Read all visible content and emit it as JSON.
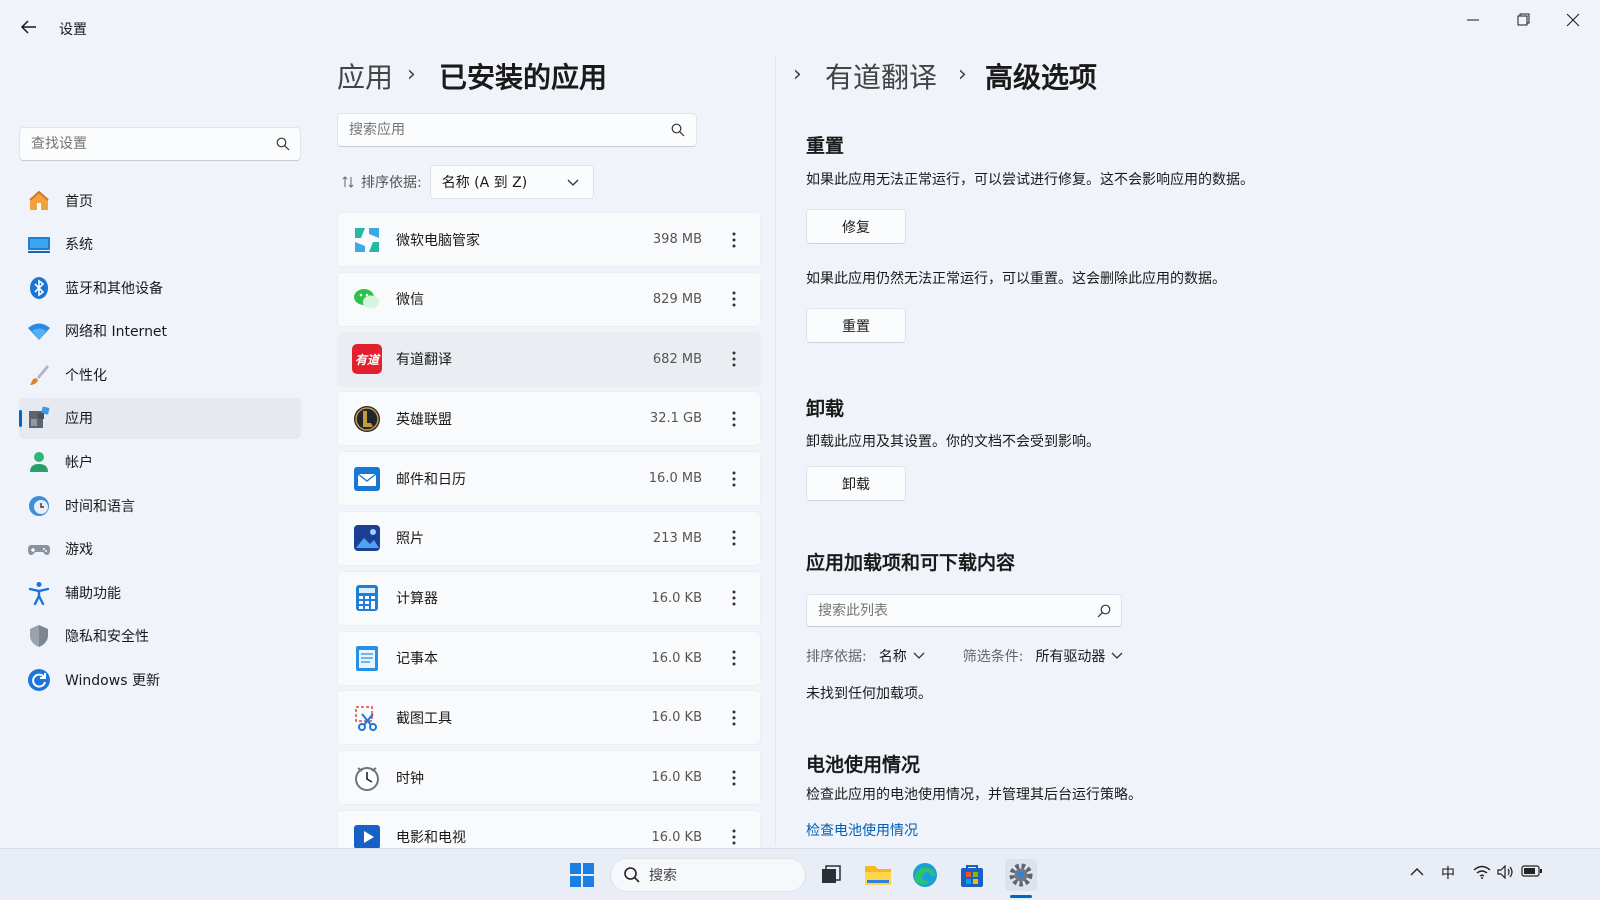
{
  "window": {
    "title": "设置"
  },
  "sidebar": {
    "search_placeholder": "查找设置",
    "items": [
      {
        "label": "首页",
        "icon": "home-icon"
      },
      {
        "label": "系统",
        "icon": "system-icon"
      },
      {
        "label": "蓝牙和其他设备",
        "icon": "bluetooth-icon"
      },
      {
        "label": "网络和 Internet",
        "icon": "wifi-icon"
      },
      {
        "label": "个性化",
        "icon": "brush-icon"
      },
      {
        "label": "应用",
        "icon": "apps-icon",
        "active": true
      },
      {
        "label": "帐户",
        "icon": "account-icon"
      },
      {
        "label": "时间和语言",
        "icon": "clock-globe-icon"
      },
      {
        "label": "游戏",
        "icon": "gamepad-icon"
      },
      {
        "label": "辅助功能",
        "icon": "accessibility-icon"
      },
      {
        "label": "隐私和安全性",
        "icon": "shield-icon"
      },
      {
        "label": "Windows 更新",
        "icon": "update-icon"
      }
    ]
  },
  "breadcrumb": {
    "apps": "应用",
    "installed": "已安装的应用",
    "app": "有道翻译",
    "advanced": "高级选项"
  },
  "installed": {
    "search_placeholder": "搜索应用",
    "sort_label": "排序依据:",
    "sort_value": "名称 (A 到 Z)",
    "apps": [
      {
        "name": "微软电脑管家",
        "size": "398 MB",
        "icon": "pc-manager-icon"
      },
      {
        "name": "微信",
        "size": "829 MB",
        "icon": "wechat-icon"
      },
      {
        "name": "有道翻译",
        "size": "682 MB",
        "icon": "youdao-icon",
        "icon_text": "有道",
        "selected": true
      },
      {
        "name": "英雄联盟",
        "size": "32.1 GB",
        "icon": "league-icon"
      },
      {
        "name": "邮件和日历",
        "size": "16.0 MB",
        "icon": "mail-icon"
      },
      {
        "name": "照片",
        "size": "213 MB",
        "icon": "photos-icon"
      },
      {
        "name": "计算器",
        "size": "16.0 KB",
        "icon": "calculator-icon"
      },
      {
        "name": "记事本",
        "size": "16.0 KB",
        "icon": "notepad-icon"
      },
      {
        "name": "截图工具",
        "size": "16.0 KB",
        "icon": "snipping-tool-icon"
      },
      {
        "name": "时钟",
        "size": "16.0 KB",
        "icon": "clock-icon"
      },
      {
        "name": "电影和电视",
        "size": "16.0 KB",
        "icon": "movies-tv-icon"
      }
    ]
  },
  "advanced": {
    "reset_section": {
      "title": "重置",
      "repair_desc": "如果此应用无法正常运行，可以尝试进行修复。这不会影响应用的数据。",
      "repair_button": "修复",
      "reset_desc": "如果此应用仍然无法正常运行，可以重置。这会删除此应用的数据。",
      "reset_button": "重置"
    },
    "uninstall_section": {
      "title": "卸载",
      "desc": "卸载此应用及其设置。你的文档不会受到影响。",
      "button": "卸载"
    },
    "addons_section": {
      "title": "应用加载项和可下载内容",
      "search_placeholder": "搜索此列表",
      "sort_label": "排序依据:",
      "sort_value": "名称",
      "filter_label": "筛选条件:",
      "filter_value": "所有驱动器",
      "empty": "未找到任何加载项。"
    },
    "battery_section": {
      "title": "电池使用情况",
      "desc": "检查此应用的电池使用情况，并管理其后台运行策略。",
      "link": "检查电池使用情况"
    }
  },
  "taskbar": {
    "search_label": "搜索",
    "ime": "中"
  },
  "colors": {
    "accent": "#0067c0",
    "link": "#005fb8",
    "youdao_red": "#e5202e"
  }
}
